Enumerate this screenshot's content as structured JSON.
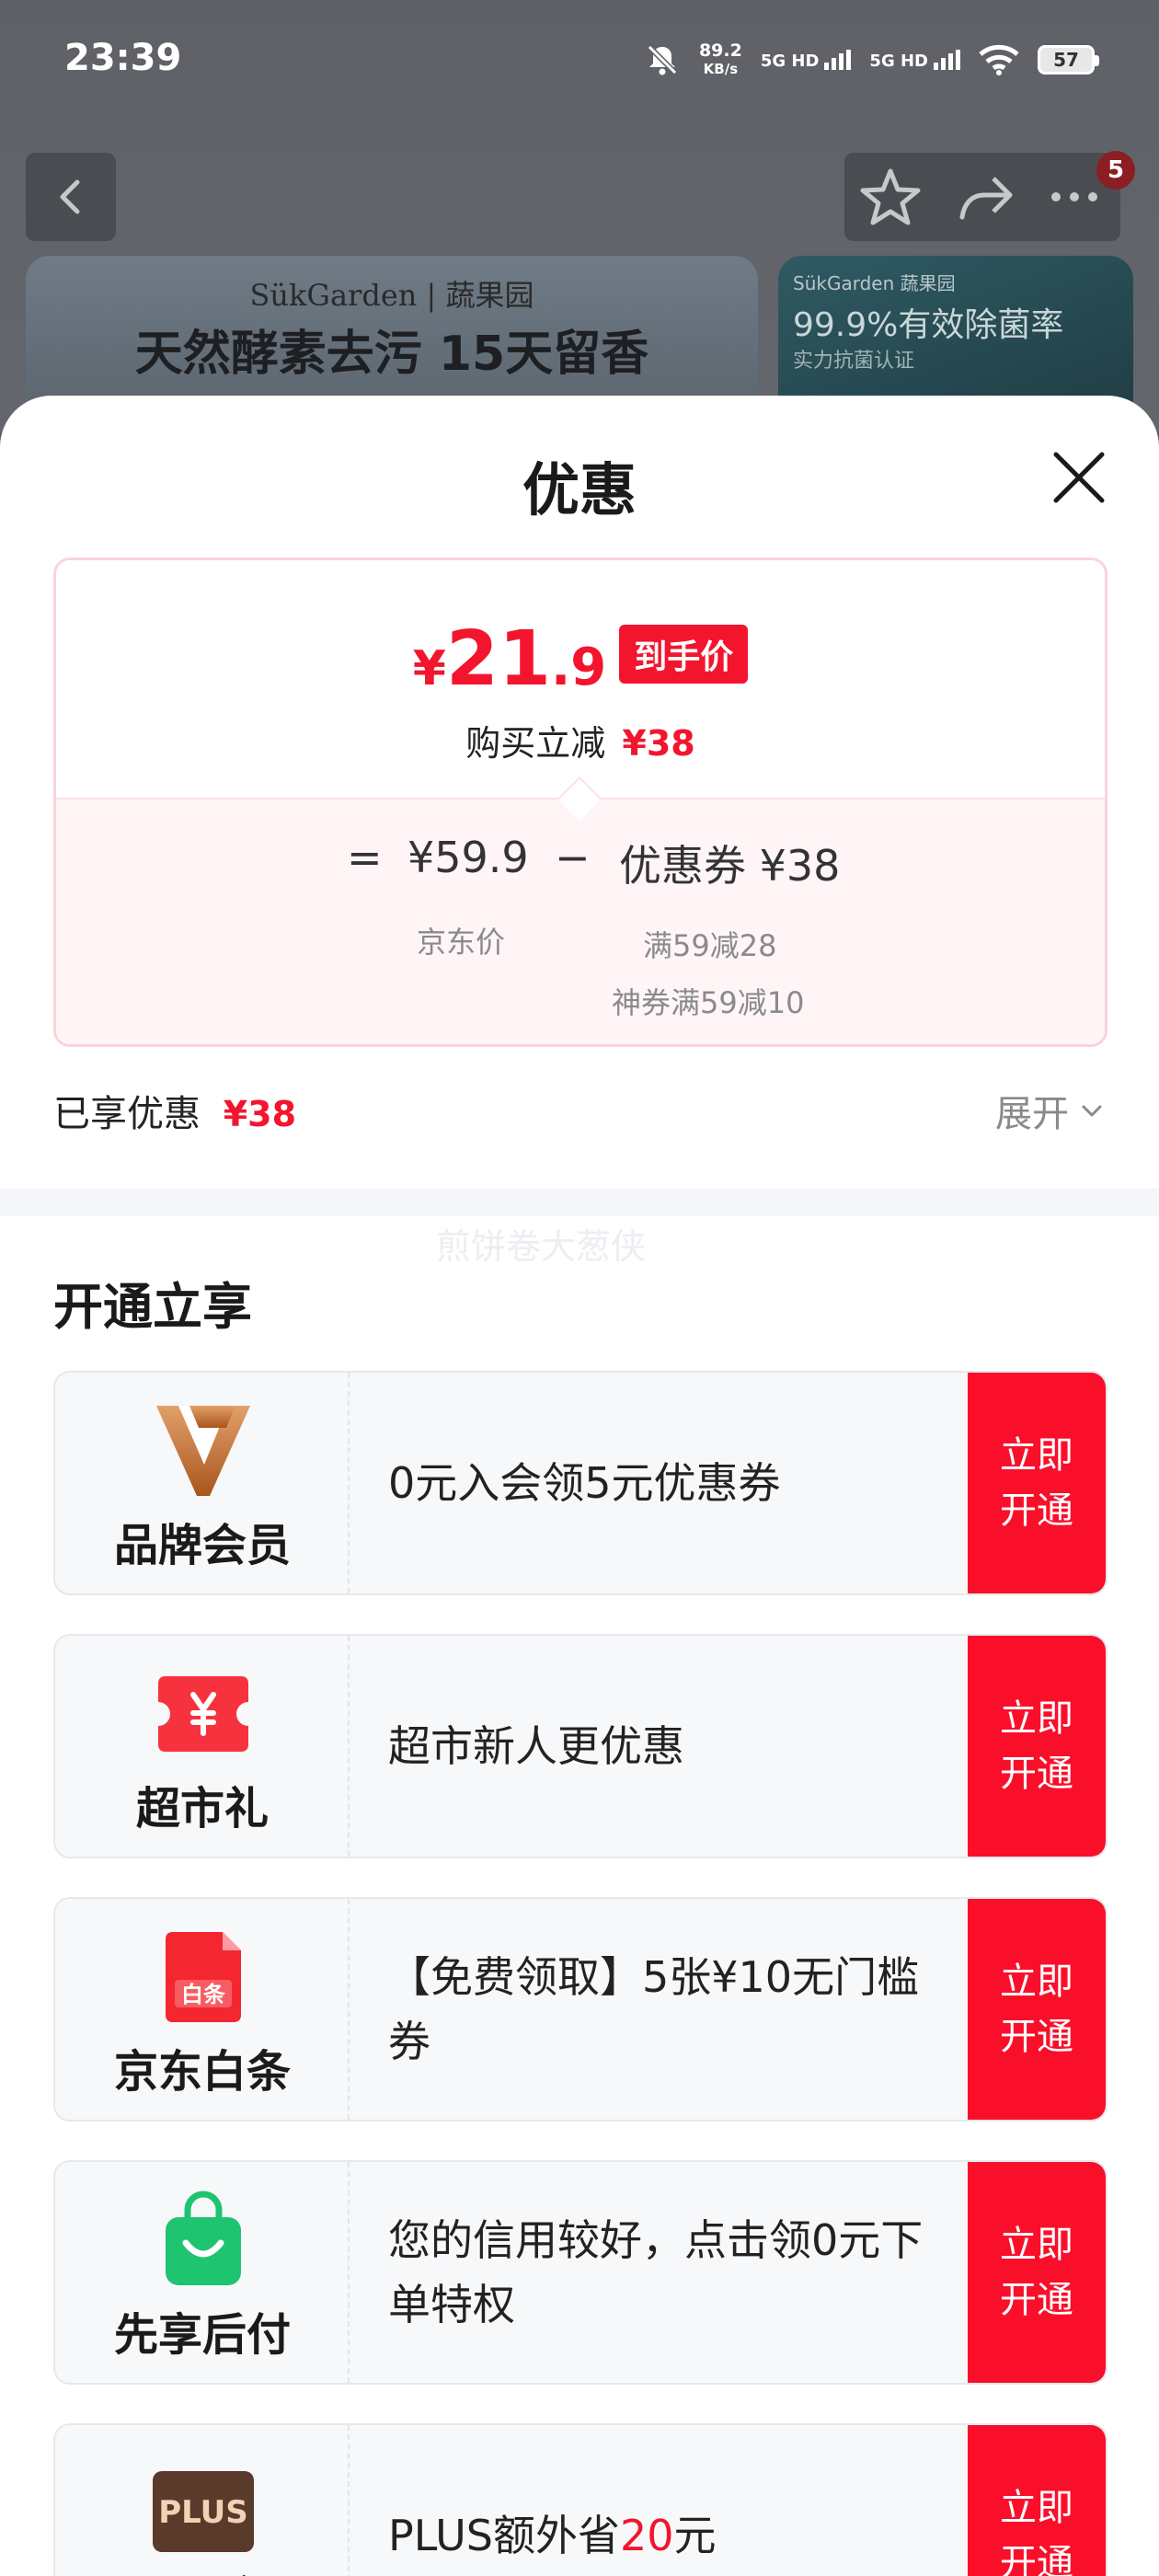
{
  "status_bar": {
    "time": "23:39",
    "speed_value": "89.2",
    "speed_unit": "KB/s",
    "network_1": "5G HD",
    "network_2": "5G HD",
    "battery": "57"
  },
  "nav": {
    "badge_count": "5"
  },
  "background": {
    "banner_brand": "SükGarden | 蔬果园",
    "banner_title": "天然酵素去污 15天留香",
    "side_brand": "SükGarden 蔬果园",
    "side_title": "99.9%有效除菌率",
    "side_sub": "实力抗菌认证"
  },
  "sheet": {
    "title": "优惠",
    "price": {
      "yen": "¥",
      "integer": "21",
      "decimal": ".9",
      "tag": "到手价",
      "reduce_label": "购买立减",
      "reduce_amount": "¥38"
    },
    "formula": {
      "equals": "=",
      "jd_price": "¥59.9",
      "minus": "−",
      "coupon": "优惠券 ¥38",
      "jd_price_label": "京东价",
      "coupon_detail_1": "满59减28",
      "coupon_detail_2": "神券满59减10"
    },
    "enjoyed_label": "已享优惠",
    "enjoyed_amount": "¥38",
    "expand_label": "展开",
    "watermark": "煎饼卷大葱侠",
    "section_title": "开通立享",
    "offers": [
      {
        "name": "品牌会员",
        "desc": "0元入会领5元优惠券",
        "button": "立即开通",
        "icon": "brand-member-icon"
      },
      {
        "name": "超市礼",
        "desc": "超市新人更优惠",
        "button": "立即开通",
        "icon": "supermarket-gift-icon"
      },
      {
        "name": "京东白条",
        "desc": "【免费领取】5张¥10无门槛券",
        "button": "立即开通",
        "icon": "jd-baitiao-icon"
      },
      {
        "name": "先享后付",
        "desc": "您的信用较好，点击领0元下单特权",
        "button": "立即开通",
        "icon": "pay-later-icon"
      },
      {
        "name": "PLUS会员",
        "desc_prefix": "PLUS额外省",
        "desc_highlight": "20",
        "desc_suffix": "元",
        "button": "立即开通",
        "icon": "plus-member-icon",
        "icon_text": "PLUS"
      }
    ]
  },
  "colors": {
    "accent_red": "#f2152d",
    "button_red": "#fa0f2b"
  }
}
